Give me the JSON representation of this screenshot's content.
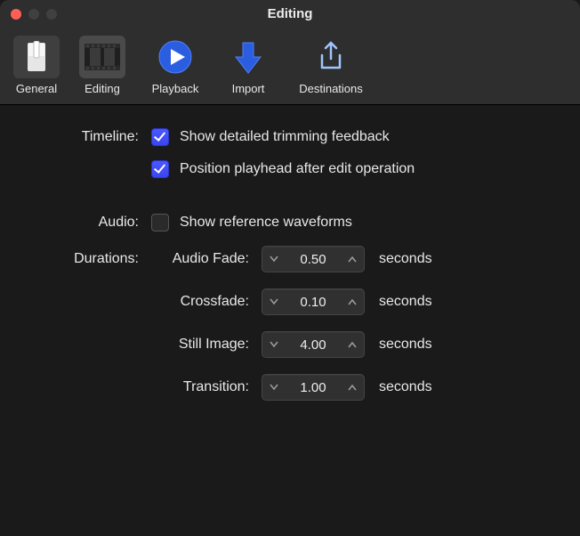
{
  "window": {
    "title": "Editing"
  },
  "toolbar": {
    "items": [
      {
        "label": "General"
      },
      {
        "label": "Editing"
      },
      {
        "label": "Playback"
      },
      {
        "label": "Import"
      },
      {
        "label": "Destinations"
      }
    ]
  },
  "timeline": {
    "label": "Timeline:",
    "opt1": "Show detailed trimming feedback",
    "opt2": "Position playhead after edit operation"
  },
  "audio": {
    "label": "Audio:",
    "opt1": "Show reference waveforms"
  },
  "durations": {
    "label": "Durations:",
    "unit": "seconds",
    "items": [
      {
        "label": "Audio Fade:",
        "value": "0.50"
      },
      {
        "label": "Crossfade:",
        "value": "0.10"
      },
      {
        "label": "Still Image:",
        "value": "4.00"
      },
      {
        "label": "Transition:",
        "value": "1.00"
      }
    ]
  }
}
